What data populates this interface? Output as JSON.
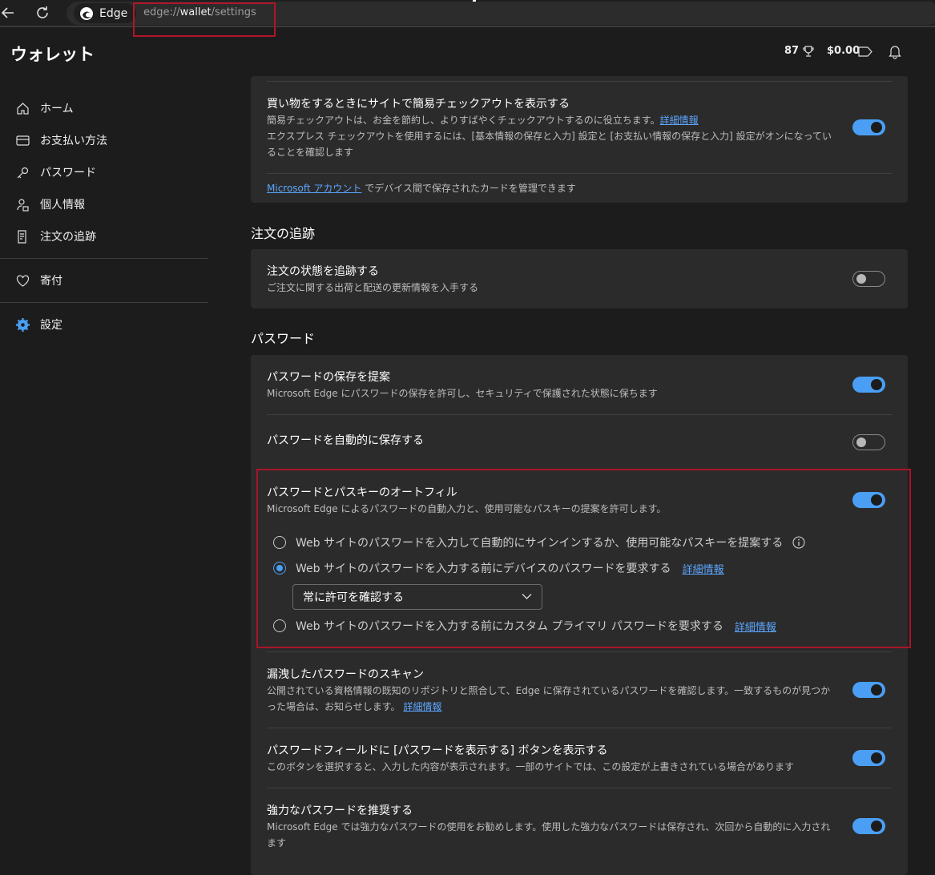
{
  "browser": {
    "tab_label": "Edge",
    "url_prefix": "edge://",
    "url_host": "wallet",
    "url_path": "/settings"
  },
  "header": {
    "title": "ウォレット",
    "points": "87",
    "balance": "$0.00"
  },
  "sidebar": {
    "items": [
      {
        "label": "ホーム",
        "icon": "home-icon"
      },
      {
        "label": "お支払い方法",
        "icon": "card-icon"
      },
      {
        "label": "パスワード",
        "icon": "key-icon"
      },
      {
        "label": "個人情報",
        "icon": "person-lock-icon"
      },
      {
        "label": "注文の追跡",
        "icon": "receipt-icon"
      },
      {
        "label": "寄付",
        "icon": "heart-icon"
      },
      {
        "label": "設定",
        "icon": "gear-icon"
      }
    ]
  },
  "checkout": {
    "title": "買い物をするときにサイトで簡易チェックアウトを表示する",
    "desc1": "簡易チェックアウトは、お金を節約し、よりすばやくチェックアウトするのに役立ちます。",
    "desc_link": "詳細情報",
    "desc2": "エクスプレス チェックアウトを使用するには、[基本情報の保存と入力] 設定と [お支払い情報の保存と入力] 設定がオンになっていることを確認します",
    "enabled": true,
    "ms_link": "Microsoft アカウント",
    "ms_text": " でデバイス間で保存されたカードを管理できます"
  },
  "order_section": {
    "heading": "注文の追跡",
    "title": "注文の状態を追跡する",
    "desc": "ご注文に関する出荷と配送の更新情報を入手する",
    "enabled": false
  },
  "password_section": {
    "heading": "パスワード",
    "offer_save": {
      "title": "パスワードの保存を提案",
      "desc": "Microsoft Edge にパスワードの保存を許可し、セキュリティで保護された状態に保ちます",
      "enabled": true
    },
    "auto_save": {
      "title": "パスワードを自動的に保存する",
      "enabled": false
    },
    "autofill": {
      "title": "パスワードとパスキーのオートフィル",
      "desc": "Microsoft Edge によるパスワードの自動入力と、使用可能なパスキーの提案を許可します。",
      "enabled": true,
      "option1": "Web サイトのパスワードを入力して自動的にサインインするか、使用可能なパスキーを提案する",
      "option2": "Web サイトのパスワードを入力する前にデバイスのパスワードを要求する",
      "option2_link": "詳細情報",
      "select_value": "常に許可を確認する",
      "option3": "Web サイトのパスワードを入力する前にカスタム プライマリ パスワードを要求する",
      "option3_link": "詳細情報",
      "selected": 2
    },
    "leak_scan": {
      "title": "漏洩したパスワードのスキャン",
      "desc": "公開されている資格情報の既知のリポジトリと照合して、Edge に保存されているパスワードを確認します。一致するものが見つかった場合は、お知らせします。",
      "link": "詳細情報",
      "enabled": true
    },
    "reveal_button": {
      "title": "パスワードフィールドに [パスワードを表示する] ボタンを表示する",
      "desc": "このボタンを選択すると、入力した内容が表示されます。一部のサイトでは、この設定が上書きされている場合があります",
      "enabled": true
    },
    "suggest_strong": {
      "title": "強力なパスワードを推奨する",
      "desc": "Microsoft Edge では強力なパスワードの使用をお勧めします。使用した強力なパスワードは保存され、次回から自動的に入力されます",
      "enabled": true
    }
  },
  "colors": {
    "accent": "#4a9ff5",
    "highlight": "#a9142a",
    "background": "#1c1c1c",
    "card": "#2b2b2b"
  }
}
